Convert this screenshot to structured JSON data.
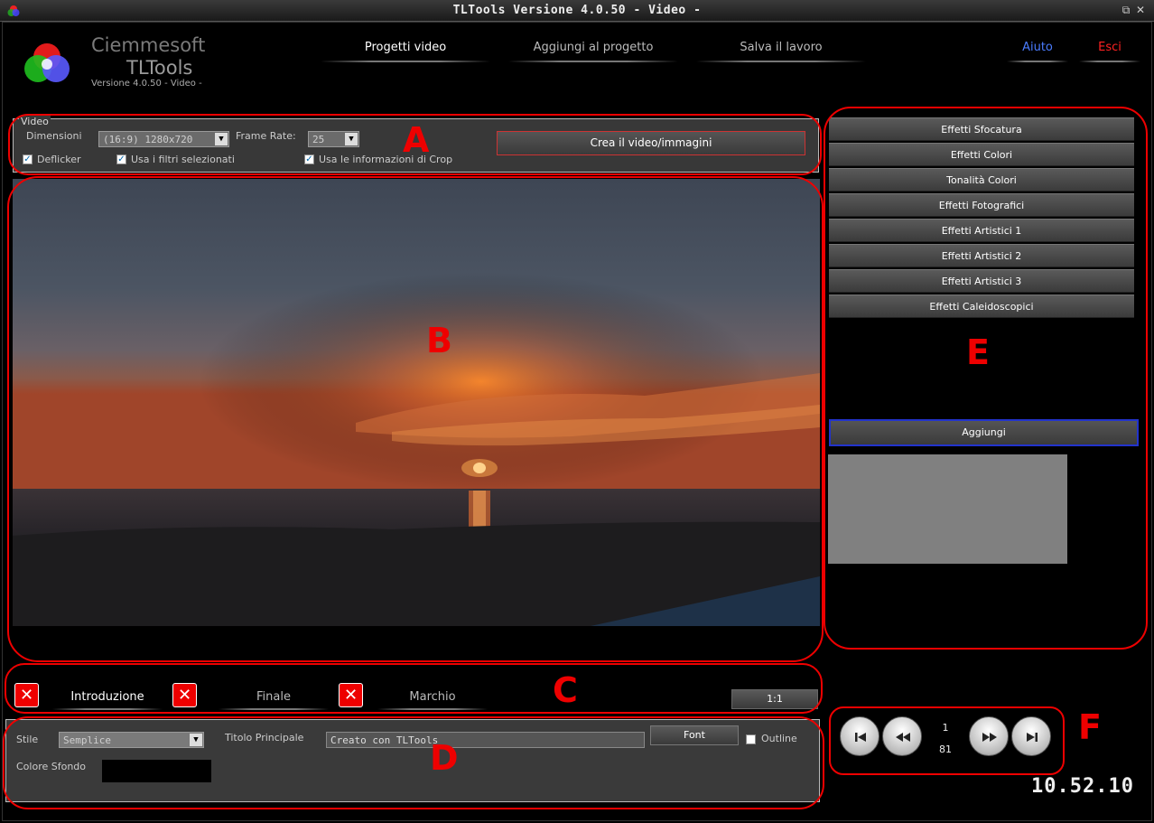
{
  "window": {
    "title": "TLTools Versione 4.0.50 - Video -"
  },
  "brand": {
    "company": "Ciemmesoft",
    "product": "TLTools",
    "version": "Versione 4.0.50 - Video -"
  },
  "nav": {
    "tabs": [
      "Progetti video",
      "Aggiungi al progetto",
      "Salva il lavoro"
    ],
    "help": "Aiuto",
    "exit": "Esci",
    "help_color": "#4a7cff",
    "exit_color": "#ff2222"
  },
  "video_panel": {
    "legend": "Video",
    "dimensions_label": "Dimensioni",
    "dimensions_value": "(16:9) 1280x720",
    "framerate_label": "Frame Rate:",
    "framerate_value": "25",
    "create_button": "Crea il video/immagini",
    "checkboxes": [
      "Deflicker",
      "Usa i filtri selezionati",
      "Usa le informazioni di Crop"
    ]
  },
  "effects": {
    "buttons": [
      "Effetti Sfocatura",
      "Effetti Colori",
      "Tonalità Colori",
      "Effetti Fotografici",
      "Effetti Artistici 1",
      "Effetti Artistici 2",
      "Effetti Artistici 3",
      "Effetti Caleidoscopici"
    ],
    "add_button": "Aggiungi"
  },
  "clip_tabs": {
    "tabs": [
      "Introduzione",
      "Finale",
      "Marchio"
    ],
    "ratio_button": "1:1"
  },
  "title_panel": {
    "style_label": "Stile",
    "style_value": "Semplice",
    "title_label": "Titolo Principale",
    "title_value": "Creato con TLTools",
    "font_button": "Font",
    "outline_label": "Outline",
    "bg_color_label": "Colore Sfondo",
    "bg_color": "#000000"
  },
  "player": {
    "current": "1",
    "total": "81"
  },
  "clock": "10.52.10",
  "annotations": [
    "A",
    "B",
    "C",
    "D",
    "E",
    "F"
  ],
  "annotation_color": "#e00000"
}
